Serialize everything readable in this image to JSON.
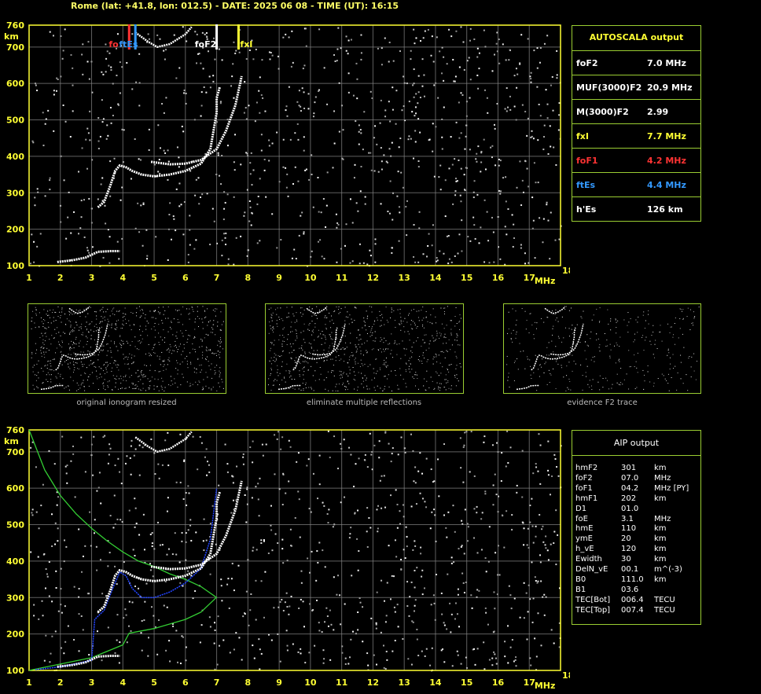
{
  "header": "Rome (lat: +41.8, lon: 012.5) - DATE: 2025 06 08 - TIME (UT): 16:15",
  "colors": {
    "axis": "#ffff33",
    "grid": "#888888",
    "trace": "#ffffff",
    "profile": "#33cc33",
    "model": "#2244ff",
    "foF1": "#ff3333",
    "ftEs": "#3399ff",
    "fxI": "#ffff33",
    "foF2": "#ffffff",
    "frame": "#9acd32"
  },
  "chart_data": [
    {
      "type": "scatter",
      "title": "",
      "xlabel": "MHz",
      "ylabel": "km",
      "xlim": [
        1,
        18
      ],
      "ylim": [
        100,
        760
      ],
      "xticks": [
        "1",
        "2",
        "3",
        "4",
        "5",
        "6",
        "7",
        "8",
        "9",
        "10",
        "11",
        "12",
        "13",
        "14",
        "15",
        "16",
        "17",
        "18"
      ],
      "yticks": [
        "100",
        "200",
        "300",
        "400",
        "500",
        "600",
        "700",
        "760"
      ],
      "grid": true,
      "markers": [
        {
          "label": "foF1",
          "x": 4.2,
          "color": "#ff3333"
        },
        {
          "label": "ftEs",
          "x": 4.4,
          "color": "#3399ff"
        },
        {
          "label": "foF2",
          "x": 7.0,
          "color": "#ffffff"
        },
        {
          "label": "fxI",
          "x": 7.7,
          "color": "#ffff33"
        }
      ],
      "series": [
        {
          "points": [
            [
              1.9,
              110
            ],
            [
              2.4,
              115
            ],
            [
              2.8,
              122
            ],
            [
              3.0,
              130
            ],
            [
              3.2,
              138
            ],
            [
              3.6,
              140
            ],
            [
              3.9,
              140
            ]
          ]
        },
        {
          "points": [
            [
              3.2,
              260
            ],
            [
              3.4,
              275
            ],
            [
              3.6,
              320
            ],
            [
              3.75,
              360
            ],
            [
              3.9,
              375
            ],
            [
              4.1,
              370
            ],
            [
              4.3,
              360
            ],
            [
              4.6,
              350
            ],
            [
              5.0,
              345
            ],
            [
              5.5,
              350
            ],
            [
              6.0,
              360
            ],
            [
              6.5,
              380
            ],
            [
              6.8,
              420
            ],
            [
              7.0,
              520
            ],
            [
              7.0,
              560
            ],
            [
              7.1,
              590
            ]
          ]
        },
        {
          "points": [
            [
              4.9,
              385
            ],
            [
              5.5,
              378
            ],
            [
              6.0,
              380
            ],
            [
              6.5,
              390
            ],
            [
              7.0,
              420
            ],
            [
              7.3,
              470
            ],
            [
              7.6,
              540
            ],
            [
              7.8,
              620
            ]
          ]
        },
        {
          "points": [
            [
              4.4,
              740
            ],
            [
              4.8,
              715
            ],
            [
              5.1,
              700
            ],
            [
              5.5,
              708
            ],
            [
              6.0,
              735
            ],
            [
              6.2,
              755
            ]
          ]
        }
      ]
    },
    {
      "type": "line",
      "title": "",
      "xlabel": "MHz",
      "ylabel": "km",
      "xlim": [
        1,
        18
      ],
      "ylim": [
        100,
        760
      ],
      "xticks": [
        "1",
        "2",
        "3",
        "4",
        "5",
        "6",
        "7",
        "8",
        "9",
        "10",
        "11",
        "12",
        "13",
        "14",
        "15",
        "16",
        "17",
        "18"
      ],
      "yticks": [
        "100",
        "200",
        "300",
        "400",
        "500",
        "600",
        "700",
        "760"
      ],
      "grid": true,
      "series": [
        {
          "points": [
            [
              1.0,
              760
            ],
            [
              1.5,
              650
            ],
            [
              2.0,
              580
            ],
            [
              2.5,
              530
            ],
            [
              3.0,
              490
            ],
            [
              3.5,
              455
            ],
            [
              4.0,
              425
            ],
            [
              4.5,
              400
            ],
            [
              5.0,
              385
            ],
            [
              5.5,
              365
            ],
            [
              6.0,
              350
            ],
            [
              6.5,
              330
            ],
            [
              7.0,
              300
            ]
          ]
        },
        {
          "points": [
            [
              1.0,
              100
            ],
            [
              3.0,
              135
            ],
            [
              4.0,
              170
            ],
            [
              4.2,
              202
            ],
            [
              5.0,
              215
            ],
            [
              6.0,
              240
            ],
            [
              6.5,
              260
            ],
            [
              7.0,
              301
            ]
          ]
        },
        {
          "points": [
            [
              1.2,
              102
            ],
            [
              2.0,
              110
            ],
            [
              2.6,
              120
            ],
            [
              3.0,
              128
            ],
            [
              3.1,
              240
            ],
            [
              3.4,
              265
            ],
            [
              3.7,
              330
            ],
            [
              3.9,
              370
            ],
            [
              4.1,
              360
            ],
            [
              4.3,
              325
            ],
            [
              4.6,
              300
            ],
            [
              5.0,
              300
            ],
            [
              5.5,
              315
            ],
            [
              6.0,
              340
            ],
            [
              6.5,
              380
            ],
            [
              6.8,
              460
            ],
            [
              7.0,
              600
            ]
          ]
        },
        {
          "points": [
            [
              1.9,
              110
            ],
            [
              2.4,
              115
            ],
            [
              2.8,
              122
            ],
            [
              3.0,
              130
            ],
            [
              3.2,
              138
            ],
            [
              3.6,
              140
            ],
            [
              3.9,
              140
            ]
          ]
        },
        {
          "points": [
            [
              3.2,
              260
            ],
            [
              3.4,
              275
            ],
            [
              3.6,
              320
            ],
            [
              3.75,
              360
            ],
            [
              3.9,
              375
            ],
            [
              4.1,
              370
            ],
            [
              4.3,
              360
            ],
            [
              4.6,
              350
            ],
            [
              5.0,
              345
            ],
            [
              5.5,
              350
            ],
            [
              6.0,
              360
            ],
            [
              6.5,
              380
            ],
            [
              6.8,
              420
            ],
            [
              7.0,
              520
            ],
            [
              7.0,
              560
            ],
            [
              7.1,
              590
            ]
          ]
        },
        {
          "points": [
            [
              4.9,
              385
            ],
            [
              5.5,
              378
            ],
            [
              6.0,
              380
            ],
            [
              6.5,
              390
            ],
            [
              7.0,
              420
            ],
            [
              7.3,
              470
            ],
            [
              7.6,
              540
            ],
            [
              7.8,
              620
            ]
          ]
        },
        {
          "points": [
            [
              4.4,
              740
            ],
            [
              4.8,
              715
            ],
            [
              5.1,
              700
            ],
            [
              5.5,
              708
            ],
            [
              6.0,
              735
            ],
            [
              6.2,
              755
            ]
          ]
        }
      ]
    }
  ],
  "autoscala": {
    "title": "AUTOSCALA output",
    "rows": [
      {
        "label": "foF2",
        "value": "7.0 MHz",
        "color": "#ffffff"
      },
      {
        "label": "MUF(3000)F2",
        "value": "20.9 MHz",
        "color": "#ffffff"
      },
      {
        "label": "M(3000)F2",
        "value": "2.99",
        "color": "#ffffff"
      },
      {
        "label": "fxI",
        "value": "7.7 MHz",
        "color": "#ffff33"
      },
      {
        "label": "foF1",
        "value": "4.2 MHz",
        "color": "#ff3333"
      },
      {
        "label": "ftEs",
        "value": "4.4 MHz",
        "color": "#3399ff"
      },
      {
        "label": "h'Es",
        "value": "126    km",
        "color": "#ffffff"
      }
    ]
  },
  "thumbnails": [
    {
      "caption": "original ionogram resized"
    },
    {
      "caption": "eliminate multiple reflections"
    },
    {
      "caption": "evidence F2 trace"
    }
  ],
  "aip": {
    "title": "AIP output",
    "rows": [
      [
        "hmF2",
        "301",
        "km"
      ],
      [
        "foF2",
        "07.0",
        "MHz"
      ],
      [
        "foF1",
        "04.2",
        "MHz    [PY]"
      ],
      [
        "hmF1",
        "202",
        "km"
      ],
      [
        "D1",
        "01.0",
        ""
      ],
      [
        "foE",
        "3.1",
        "MHz"
      ],
      [
        "hmE",
        "110",
        "km"
      ],
      [
        "ymE",
        "20",
        "km"
      ],
      [
        "h_vE",
        "120",
        "km"
      ],
      [
        "Ewidth",
        "30",
        "km"
      ],
      [
        "DelN_vE",
        "00.1",
        "m^(-3)"
      ],
      [
        "B0",
        "111.0",
        "km"
      ],
      [
        "B1",
        "03.6",
        ""
      ],
      [
        "TEC[Bot]",
        "006.4",
        "TECU"
      ],
      [
        "TEC[Top]",
        "007.4",
        "TECU"
      ]
    ]
  }
}
